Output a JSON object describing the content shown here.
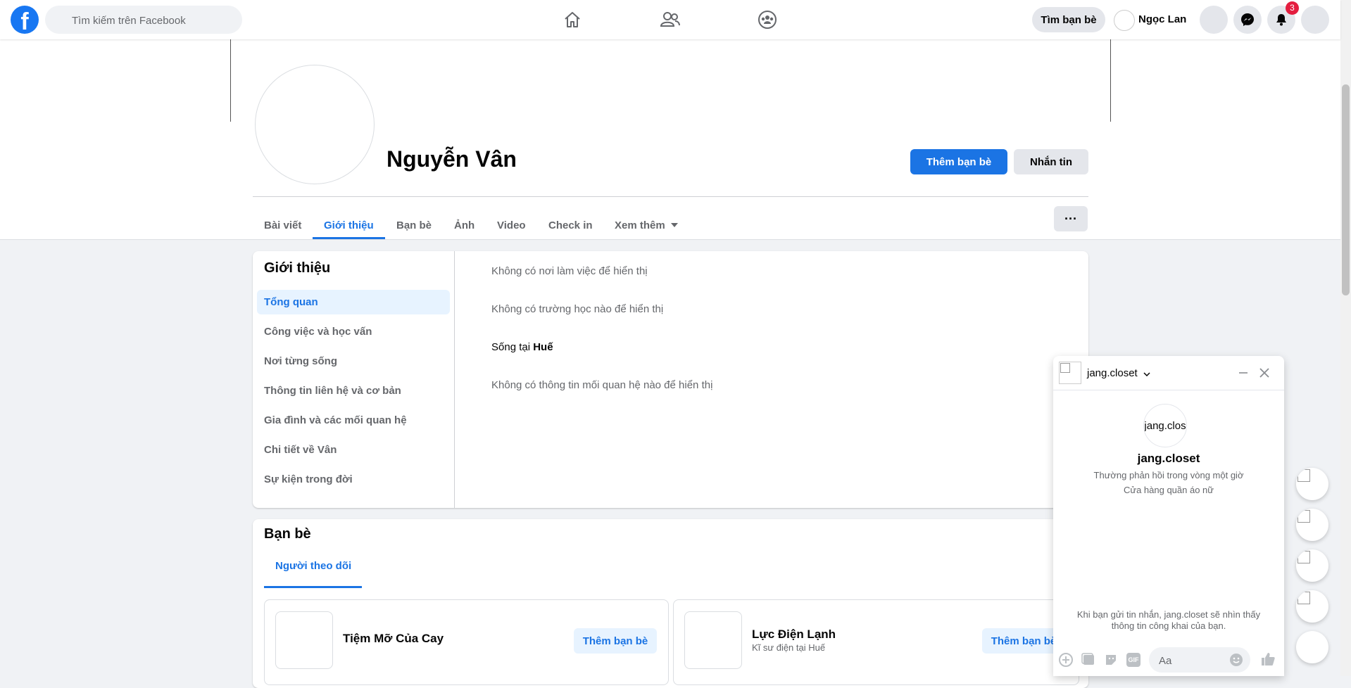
{
  "topbar": {
    "logo_letter": "f",
    "search_placeholder": "Tìm kiếm trên Facebook",
    "find_friends": "Tìm bạn bè",
    "user_name": "Ngọc Lan",
    "notification_count": "3"
  },
  "profile": {
    "name": "Nguyễn Vân",
    "add_friend": "Thêm bạn bè",
    "message": "Nhắn tin",
    "more": "···"
  },
  "tabs": [
    "Bài viết",
    "Giới thiệu",
    "Bạn bè",
    "Ảnh",
    "Video",
    "Check in",
    "Xem thêm"
  ],
  "intro": {
    "title": "Giới thiệu",
    "menu": [
      "Tổng quan",
      "Công việc và học vấn",
      "Nơi từng sống",
      "Thông tin liên hệ và cơ bản",
      "Gia đình và các mối quan hệ",
      "Chi tiết về Vân",
      "Sự kiện trong đời"
    ],
    "lines": {
      "work": "Không có nơi làm việc để hiển thị",
      "school": "Không có trường học nào để hiển thị",
      "lives_prefix": "Sống tại ",
      "lives_city": "Huế",
      "relationship": "Không có thông tin mối quan hệ nào để hiển thị"
    }
  },
  "friends": {
    "title": "Bạn bè",
    "subtab": "Người theo dõi",
    "items": [
      {
        "name": "Tiệm Mỡ Của Cay",
        "sub": "",
        "button": "Thêm bạn bè"
      },
      {
        "name": "Lực Điện Lạnh",
        "sub": "Kĩ sư điện tại Huế",
        "button": "Thêm bạn bè"
      }
    ]
  },
  "chat": {
    "title": "jang.closet",
    "avatar_text": "jang.clos",
    "name": "jang.closet",
    "response_time": "Thường phản hồi trong vòng một giờ",
    "category": "Cửa hàng quần áo nữ",
    "note": "Khi bạn gửi tin nhắn, jang.closet sẽ nhìn thấy thông tin công khai của bạn.",
    "input_placeholder": "Aa",
    "gif_label": "GIF"
  },
  "colors": {
    "brand": "#1877f2",
    "primary_button": "#1b74e4",
    "badge": "#e41e3f"
  }
}
